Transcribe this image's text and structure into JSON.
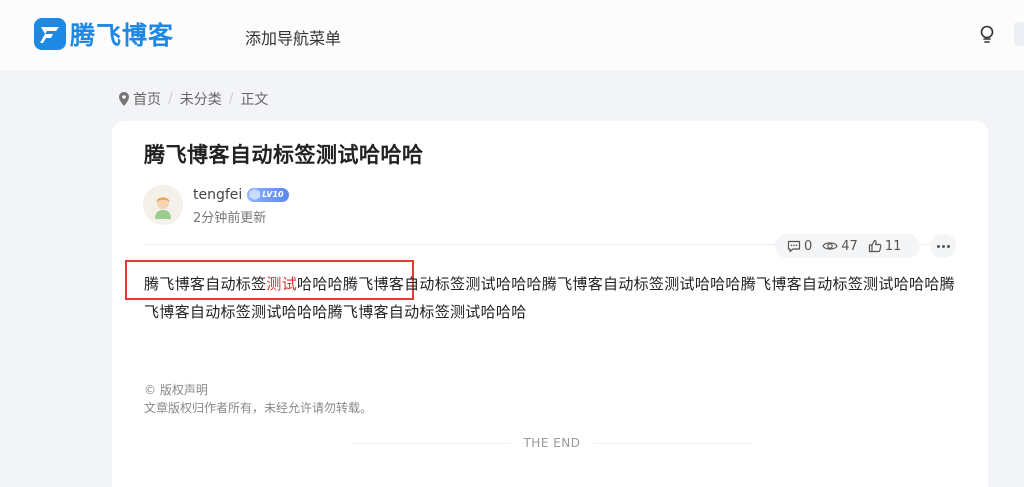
{
  "site": {
    "name": "腾飞博客"
  },
  "nav": {
    "items": [
      {
        "label": "添加导航菜单"
      }
    ]
  },
  "breadcrumb": {
    "items": [
      "首页",
      "未分类",
      "正文"
    ]
  },
  "post": {
    "title": "腾飞博客自动标签测试哈哈哈",
    "author": "tengfei",
    "level": "LV10",
    "updated": "2分钟前更新",
    "stats": {
      "comments": "0",
      "views": "47",
      "likes": "11"
    },
    "content_before": "腾飞博客自动标签",
    "content_tag": "测试",
    "content_after": "哈哈哈腾飞博客自动标签测试哈哈哈腾飞博客自动标签测试哈哈哈腾飞博客自动标签测试哈哈哈腾飞博客自动标签测试哈哈哈腾飞博客自动标签测试哈哈哈",
    "copyright_title": "© 版权声明",
    "copyright_text": "文章版权归作者所有，未经允许请勿转载。",
    "end_text": "THE END"
  },
  "colors": {
    "brand": "#1e88e5",
    "tag": "#d32f2f",
    "highlight": "#e53935"
  },
  "icons": [
    "logo-icon",
    "bulb-icon",
    "location-pin-icon",
    "comment-icon",
    "eye-icon",
    "thumbs-up-icon",
    "more-icon"
  ]
}
